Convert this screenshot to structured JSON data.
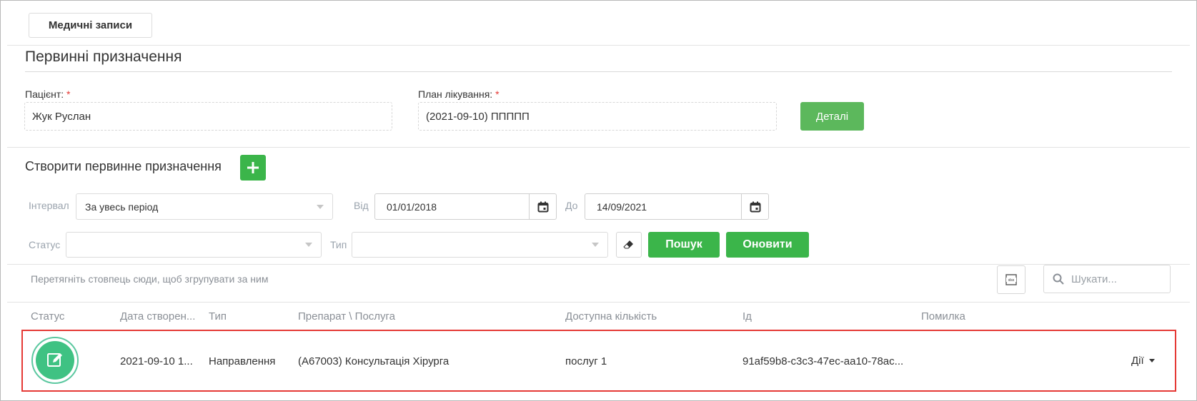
{
  "top_tab": {
    "label": "Медичні записи"
  },
  "page": {
    "title": "Первинні призначення"
  },
  "patient": {
    "label": "Пацієнт:",
    "required_mark": "*",
    "value": "Жук Руслан"
  },
  "plan": {
    "label": "План лікування:",
    "required_mark": "*",
    "value": "(2021-09-10) ППППП"
  },
  "details_button": {
    "label": "Деталі"
  },
  "create": {
    "title": "Створити первинне призначення"
  },
  "filters": {
    "interval_label": "Інтервал",
    "interval_value": "За увесь період",
    "from_label": "Від",
    "from_value": "01/01/2018",
    "to_label": "До",
    "to_value": "14/09/2021",
    "status_label": "Статус",
    "status_value": "",
    "type_label": "Тип",
    "type_value": "",
    "search_button": "Пошук",
    "refresh_button": "Оновити"
  },
  "grid": {
    "group_hint": "Перетягніть стовпець сюди, щоб згрупувати за ним",
    "export_icon": "xlsx-export-icon",
    "search_placeholder": "Шукати...",
    "columns": [
      "Статус",
      "Дата створен...",
      "Тип",
      "Препарат \\ Послуга",
      "Доступна кількість",
      "Ід",
      "Помилка"
    ],
    "rows": [
      {
        "status_icon": "edit-icon",
        "date": "2021-09-10 1...",
        "type": "Направлення",
        "service": "(A67003) Консультація Хірурга",
        "available": "послуг 1",
        "id": "91af59b8-c3c3-47ec-aa10-78ac...",
        "error": "",
        "actions_label": "Дії"
      }
    ]
  },
  "colors": {
    "accent_green": "#3bb54a",
    "status_green": "#3fc283",
    "highlight_red": "#e53935"
  }
}
